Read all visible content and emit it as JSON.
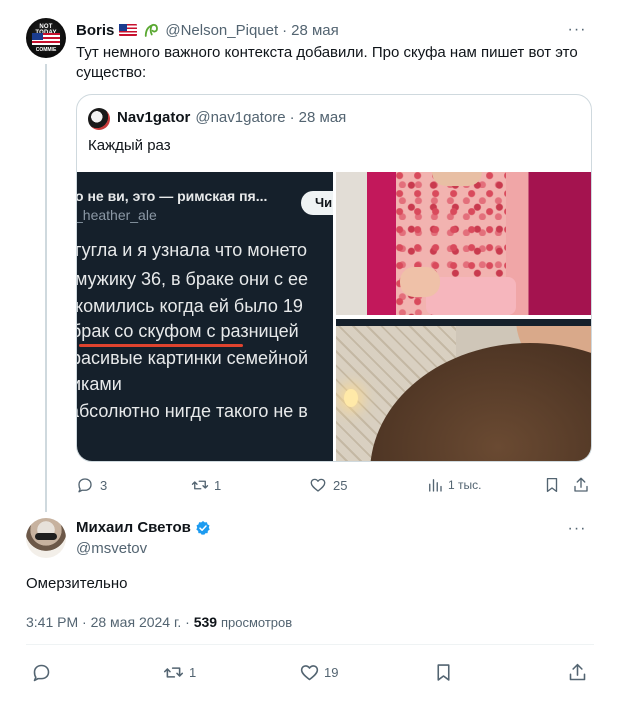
{
  "parent_tweet": {
    "author_name": "Boris",
    "handle": "@Nelson_Piquet",
    "date": "28 мая",
    "avatar_text_top": "NOT TODAY",
    "avatar_text_bottom": "COMMIE",
    "text": "Тут немного важного контекста добавили. Про скуфа нам пишет вот это существо:",
    "quote": {
      "author_name": "Nav1gator",
      "handle": "@nav1gatore",
      "date": "28 мая",
      "text": "Каждый раз",
      "screenshot_title": "о не ви, это — римская пя...",
      "screenshot_handle": "_heather_ale",
      "screenshot_button": "Чи",
      "screenshot_lines": [
        "гугла и я узнала что монето",
        "мужику 36, в браке они с ее",
        "комились когда ей было 19",
        "брак со скуфом с разницей",
        "расивые картинки семейной",
        "иками",
        "абсолютно нигде такого не в"
      ]
    },
    "stats": {
      "replies": "3",
      "reposts": "1",
      "likes": "25",
      "views": "1 тыс."
    }
  },
  "main_tweet": {
    "author_name": "Михаил Светов",
    "handle": "@msvetov",
    "text": "Омерзительно",
    "time": "3:41 PM",
    "date": "28 мая 2024 г.",
    "views_count": "539",
    "views_label": "просмотров",
    "stats": {
      "reposts": "1",
      "likes": "19"
    }
  },
  "colors": {
    "text_primary": "#0f1419",
    "text_secondary": "#536471",
    "border": "#cfd9de",
    "verified": "#1d9bf0",
    "highlight_underline": "#e0432e"
  }
}
